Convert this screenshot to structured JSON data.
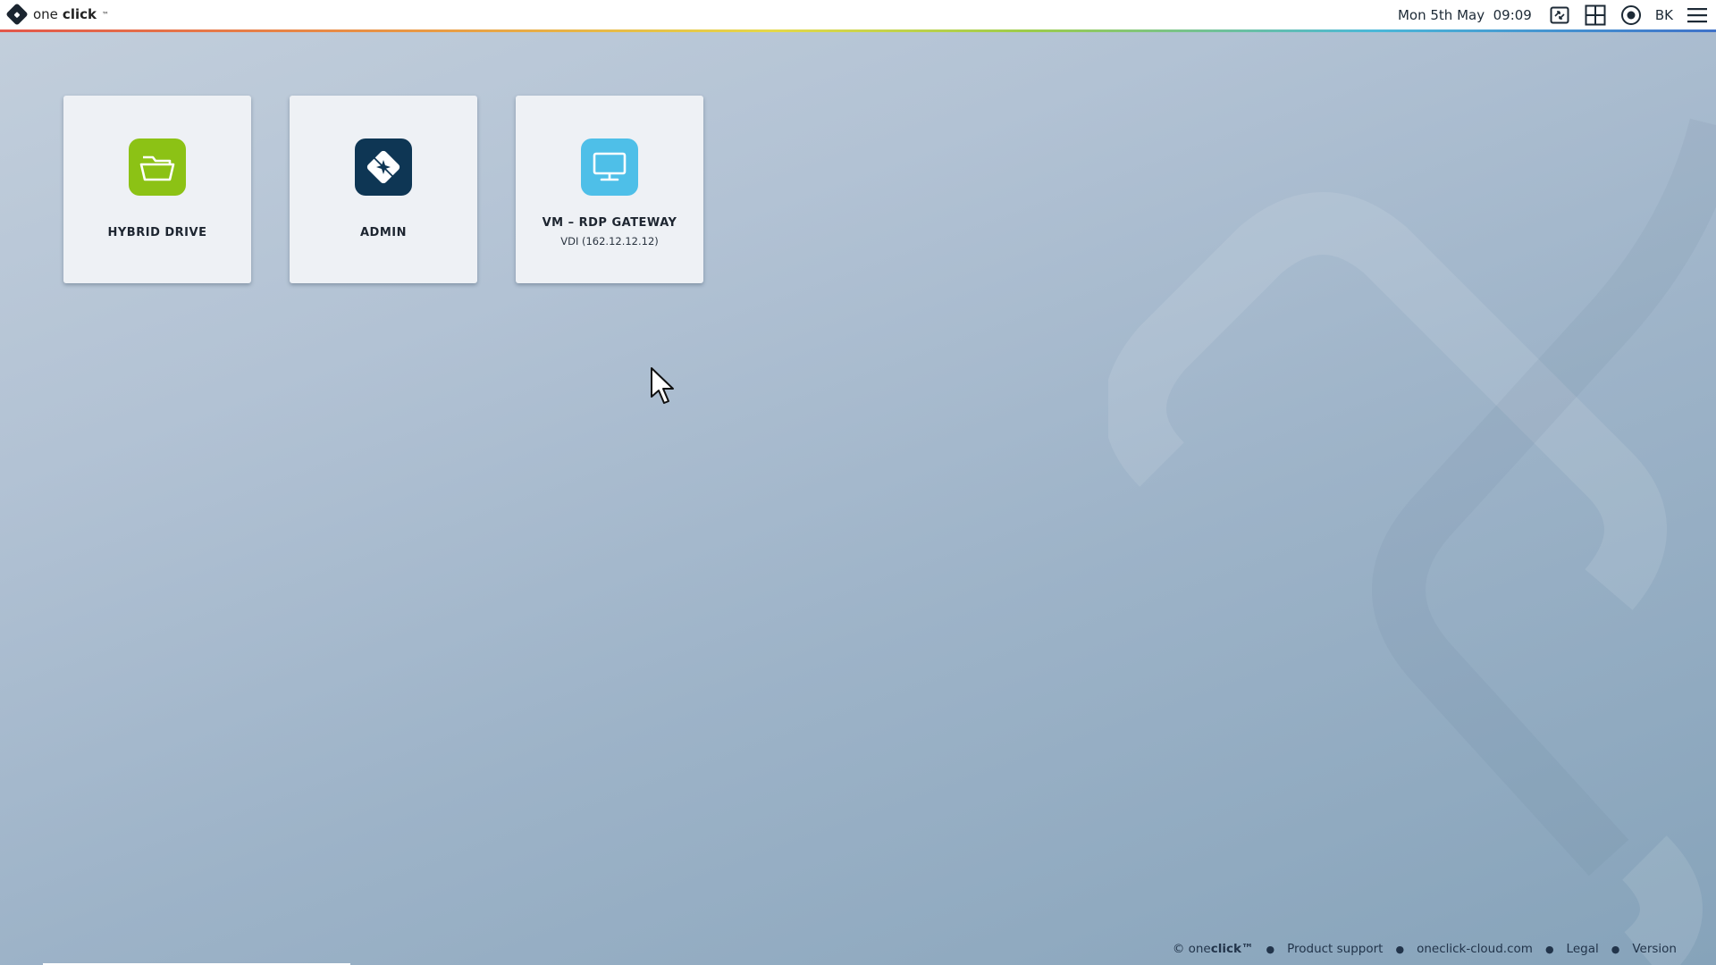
{
  "header": {
    "logo_one": "one",
    "logo_click": "click",
    "logo_tm": "™",
    "date": "Mon 5th May",
    "time": "09:09",
    "user_initials": "BK",
    "icons": [
      "remote-session-icon",
      "app-grid-icon",
      "record-icon",
      "hamburger-menu-icon"
    ]
  },
  "tiles": [
    {
      "title": "HYBRID DRIVE",
      "subtitle": "",
      "icon": "folder-icon",
      "color": "#8cc215"
    },
    {
      "title": "ADMIN",
      "subtitle": "",
      "icon": "oneclick-admin-icon",
      "color": "#0e3654"
    },
    {
      "title": "VM – RDP GATEWAY",
      "subtitle": "VDI (162.12.12.12)",
      "icon": "monitor-icon",
      "color": "#4ebfe8"
    }
  ],
  "footer": {
    "copyright_prefix": "© one",
    "copyright_brand": "click™",
    "links": [
      "Product support",
      "oneclick-cloud.com",
      "Legal",
      "Version"
    ]
  }
}
